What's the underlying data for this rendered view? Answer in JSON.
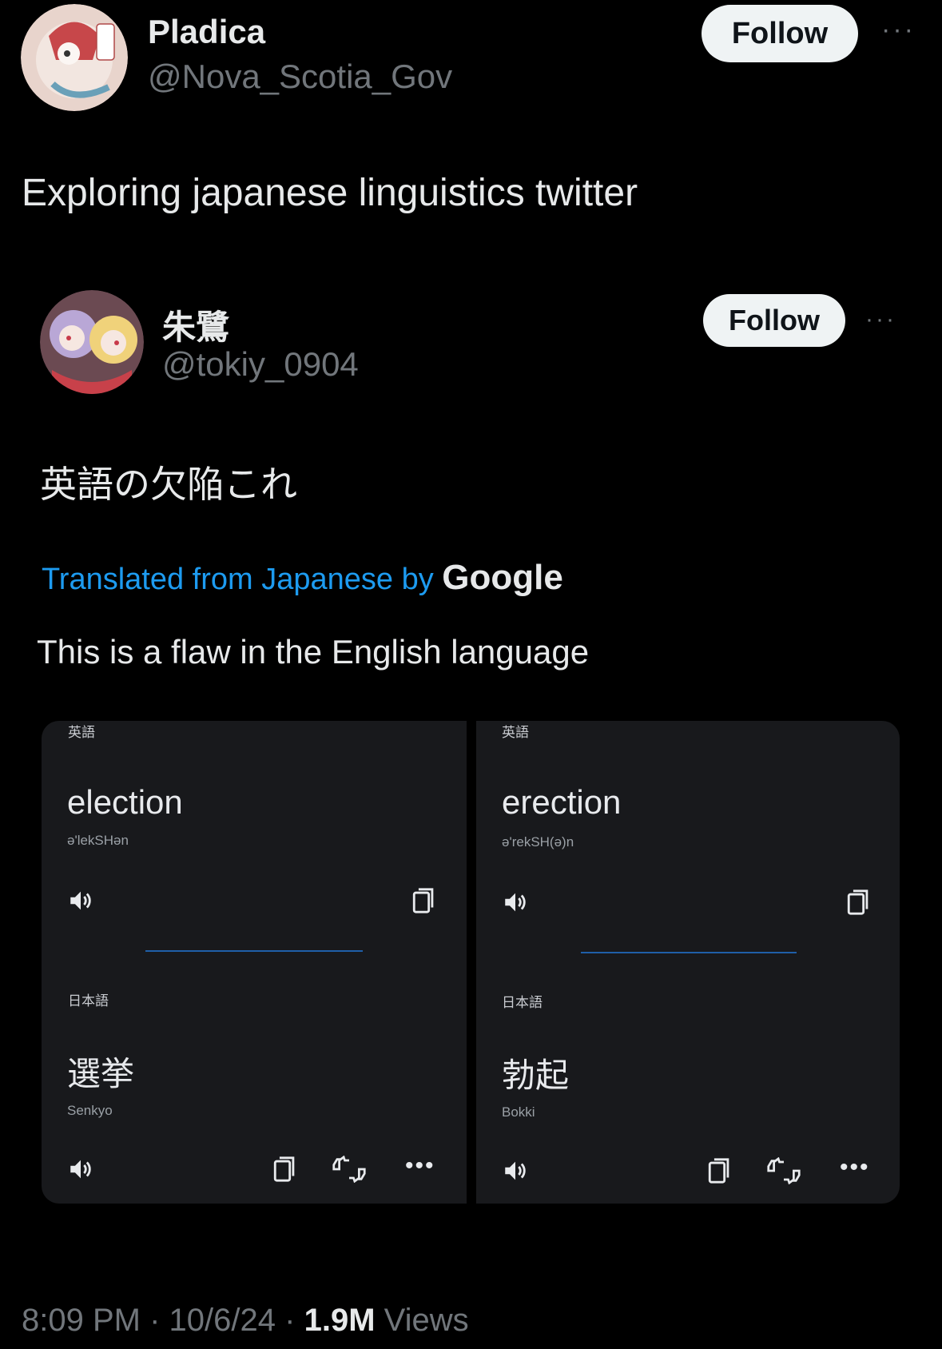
{
  "outer_tweet": {
    "display_name": "Pladica",
    "handle": "@Nova_Scotia_Gov",
    "follow_label": "Follow",
    "more_label": "···",
    "text": "Exploring japanese linguistics twitter"
  },
  "quoted_tweet": {
    "display_name": "朱鷺",
    "handle": "@tokiy_0904",
    "follow_label": "Follow",
    "more_label": "···",
    "text": "英語の欠陥これ",
    "translated_prefix": "Translated from Japanese by",
    "translated_brand": "Google",
    "translation": "This is a flaw in the English language"
  },
  "cards": [
    {
      "source_lang": "英語",
      "word": "election",
      "phonetic": "ə'lekSHən",
      "target_lang": "日本語",
      "translation": "選挙",
      "romanization": "Senkyo"
    },
    {
      "source_lang": "英語",
      "word": "erection",
      "phonetic": "ə'rekSH(ə)n",
      "target_lang": "日本語",
      "translation": "勃起",
      "romanization": "Bokki"
    }
  ],
  "footer": {
    "time": "8:09 PM",
    "date": "10/6/24",
    "views_count": "1.9M",
    "views_label": "Views",
    "separator": "·"
  },
  "icons": {
    "speaker": "speaker-icon",
    "copy": "copy-icon",
    "feedback": "thumbs-feedback-icon",
    "more": "more-icon"
  }
}
